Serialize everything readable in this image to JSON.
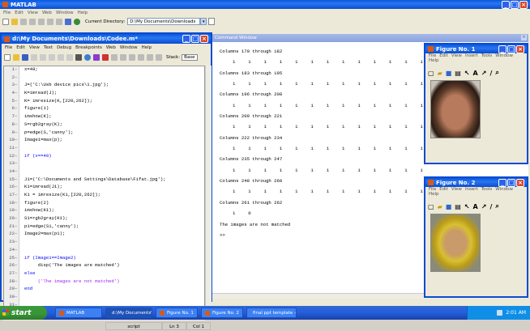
{
  "matlab": {
    "title": "MATLAB",
    "menu": [
      "File",
      "Edit",
      "View",
      "Web",
      "Window",
      "Help"
    ],
    "current_dir_label": "Current Directory:",
    "current_dir_value": "D:\\My Documents\\Downloads"
  },
  "command_window": {
    "title": "Command Window",
    "lines": [
      {
        "type": "text",
        "text": "Columns 170 through 182"
      },
      {
        "type": "nums",
        "values": [
          1,
          1,
          1,
          1,
          1,
          1,
          1,
          1,
          1,
          1,
          1,
          1,
          1
        ]
      },
      {
        "type": "text",
        "text": "Columns 183 through 195"
      },
      {
        "type": "nums",
        "values": [
          1,
          1,
          1,
          1,
          1,
          1,
          1,
          1,
          1,
          1,
          1,
          1,
          1
        ]
      },
      {
        "type": "text",
        "text": "Columns 196 through 208"
      },
      {
        "type": "nums",
        "values": [
          1,
          1,
          1,
          1,
          1,
          1,
          1,
          1,
          1,
          1,
          1,
          1,
          1
        ]
      },
      {
        "type": "text",
        "text": "Columns 209 through 221"
      },
      {
        "type": "nums",
        "values": [
          1,
          1,
          1,
          1,
          1,
          1,
          1,
          1,
          1,
          1,
          1,
          1,
          1
        ]
      },
      {
        "type": "text",
        "text": "Columns 222 through 234"
      },
      {
        "type": "nums",
        "values": [
          1,
          1,
          1,
          1,
          1,
          1,
          1,
          1,
          1,
          1,
          1,
          1,
          1
        ]
      },
      {
        "type": "text",
        "text": "Columns 235 through 247"
      },
      {
        "type": "nums",
        "values": [
          1,
          1,
          1,
          1,
          1,
          1,
          1,
          1,
          1,
          1,
          1,
          1,
          1
        ]
      },
      {
        "type": "text",
        "text": "Columns 248 through 260"
      },
      {
        "type": "nums",
        "values": [
          1,
          1,
          1,
          1,
          1,
          1,
          1,
          1,
          1,
          1,
          1,
          1,
          1
        ]
      },
      {
        "type": "text",
        "text": "Columns 261 through 262"
      },
      {
        "type": "nums",
        "values": [
          1,
          0
        ]
      },
      {
        "type": "text",
        "text": "The images are not matched"
      },
      {
        "type": "text",
        "text": ">>"
      }
    ]
  },
  "editor": {
    "title": "d:\\My Documents\\Downloads\\Codee.m*",
    "menu": [
      "File",
      "Edit",
      "View",
      "Text",
      "Debug",
      "Breakpoints",
      "Web",
      "Window",
      "Help"
    ],
    "stack_label": "Stack:",
    "stack_value": "Base",
    "status_mode": "script",
    "status_ln": "Ln 3",
    "status_col": "Col 1",
    "lines": [
      {
        "n": 1,
        "t": "x=49;"
      },
      {
        "n": 2,
        "t": ""
      },
      {
        "n": 3,
        "t": "J=('C:\\Usb device pics\\1.jpg');"
      },
      {
        "n": 4,
        "t": "K=imread(J);"
      },
      {
        "n": 5,
        "t": "K= imresize(K,[220,262]);"
      },
      {
        "n": 6,
        "t": "figure(1)"
      },
      {
        "n": 7,
        "t": "imshow(K);"
      },
      {
        "n": 8,
        "t": "S=rgb2gray(K);"
      },
      {
        "n": 9,
        "t": "p=edge(S,'canny');"
      },
      {
        "n": 10,
        "t": "Image1=max(p);"
      },
      {
        "n": 11,
        "t": ""
      },
      {
        "n": 12,
        "t": "if (x==49)"
      },
      {
        "n": 13,
        "t": ""
      },
      {
        "n": 14,
        "t": ""
      },
      {
        "n": 15,
        "t": "J1=('C:\\Documents and Settings\\Database\\Fifat.jpg');"
      },
      {
        "n": 16,
        "t": "K1=imread(J1);"
      },
      {
        "n": 17,
        "t": "K1 = imresize(K1,[220,262]);"
      },
      {
        "n": 18,
        "t": "figure(2)"
      },
      {
        "n": 19,
        "t": "imshow(K1);"
      },
      {
        "n": 20,
        "t": "S1=rgb2gray(K1);"
      },
      {
        "n": 21,
        "t": "p1=edge(S1,'canny');"
      },
      {
        "n": 22,
        "t": "Image2=max(p1);"
      },
      {
        "n": 23,
        "t": ""
      },
      {
        "n": 24,
        "t": ""
      },
      {
        "n": 25,
        "t": "if (Image1==Image2)"
      },
      {
        "n": 26,
        "t": "     disp('The images are matched')"
      },
      {
        "n": 27,
        "t": "else"
      },
      {
        "n": 28,
        "t": "     ('The images are not matched')"
      },
      {
        "n": 29,
        "t": "end"
      },
      {
        "n": 30,
        "t": ""
      },
      {
        "n": 31,
        "t": ""
      },
      {
        "n": 32,
        "t": ""
      }
    ]
  },
  "figure1": {
    "title": "Figure No. 1",
    "menu": [
      "File",
      "Edit",
      "View",
      "Insert",
      "Tools",
      "Window",
      "Help"
    ]
  },
  "figure2": {
    "title": "Figure No. 2",
    "menu": [
      "File",
      "Edit",
      "View",
      "Insert",
      "Tools",
      "Window",
      "Help"
    ]
  },
  "taskbar": {
    "start": "start",
    "buttons": [
      "MATLAB",
      "d:\\My Documents\\Do...",
      "Figure No. 1",
      "Figure No. 2",
      "final ppt template - C..."
    ],
    "time": "2:01 AM"
  },
  "colors": {
    "accent": "#0a4cd0",
    "keyword": "#0000ff",
    "string": "#a020f0"
  }
}
